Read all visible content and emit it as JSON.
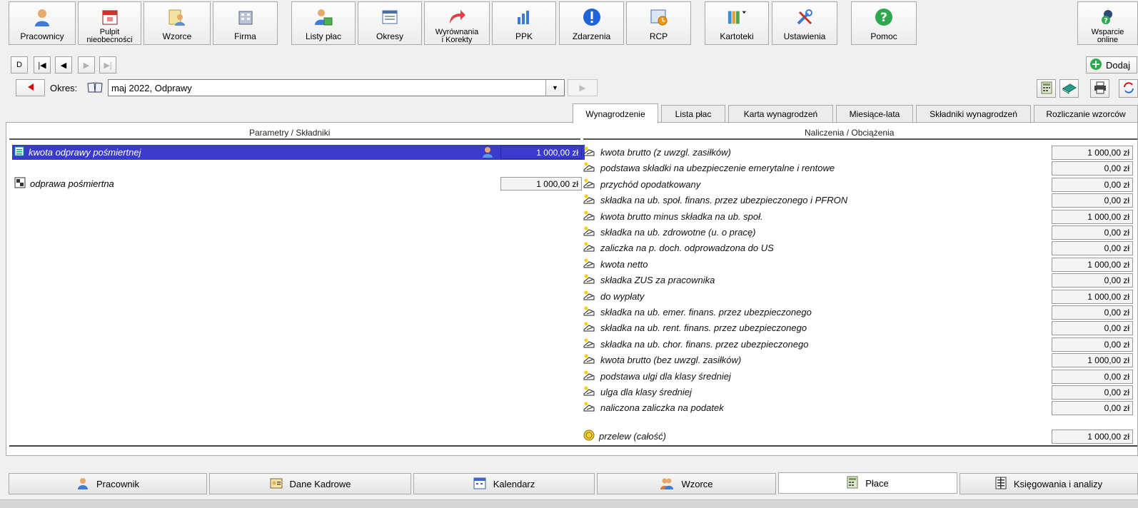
{
  "toolbar": {
    "pracownicy": "Pracownicy",
    "pulpit": "Pulpit\nnieobecności",
    "wzorce": "Wzorce",
    "firma": "Firma",
    "listy_plac": "Listy płac",
    "okresy": "Okresy",
    "wyrownania": "Wyrównania\ni Korekty",
    "ppk": "PPK",
    "zdarzenia": "Zdarzenia",
    "rcp": "RCP",
    "kartoteki": "Kartoteki",
    "ustawienia": "Ustawienia",
    "pomoc": "Pomoc",
    "wsparcie": "Wsparcie\nonline"
  },
  "nav": {
    "first_label": "D",
    "dodaj": "Dodaj"
  },
  "period": {
    "label": "Okres:",
    "value": "maj 2022, Odprawy"
  },
  "tabs": [
    {
      "label": "Wynagrodzenie",
      "active": true
    },
    {
      "label": "Lista płac"
    },
    {
      "label": "Karta wynagrodzeń"
    },
    {
      "label": "Miesiące-lata"
    },
    {
      "label": "Składniki wynagrodzeń"
    },
    {
      "label": "Rozliczanie wzorców"
    }
  ],
  "left": {
    "header": "Parametry / Składniki",
    "rows": [
      {
        "name": "kwota odprawy pośmiertnej",
        "value": "1 000,00 zł"
      },
      {
        "name": "odprawa pośmiertna",
        "value": "1 000,00 zł"
      }
    ]
  },
  "right": {
    "header": "Naliczenia / Obciążenia",
    "rows": [
      {
        "name": "kwota brutto (z uwzgl. zasiłków)",
        "value": "1 000,00 zł"
      },
      {
        "name": "podstawa składki na ubezpieczenie emerytalne i rentowe",
        "value": "0,00 zł"
      },
      {
        "name": "przychód opodatkowany",
        "value": "0,00 zł"
      },
      {
        "name": "składka na ub. społ. finans. przez ubezpieczonego i PFRON",
        "value": "0,00 zł"
      },
      {
        "name": "kwota brutto minus składka na ub. społ.",
        "value": "1 000,00 zł"
      },
      {
        "name": "składka na ub. zdrowotne (u. o pracę)",
        "value": "0,00 zł"
      },
      {
        "name": "zaliczka na p. doch. odprowadzona do US",
        "value": "0,00 zł"
      },
      {
        "name": "kwota netto",
        "value": "1 000,00 zł"
      },
      {
        "name": "składka ZUS za pracownika",
        "value": "0,00 zł"
      },
      {
        "name": "do wypłaty",
        "value": "1 000,00 zł"
      },
      {
        "name": "składka na ub. emer. finans. przez ubezpieczonego",
        "value": "0,00 zł"
      },
      {
        "name": "składka na ub. rent. finans. przez ubezpieczonego",
        "value": "0,00 zł"
      },
      {
        "name": "składka na ub. chor. finans. przez ubezpieczonego",
        "value": "0,00 zł"
      },
      {
        "name": "kwota brutto (bez uwzgl. zasiłków)",
        "value": "1 000,00 zł"
      },
      {
        "name": "podstawa ulgi dla klasy średniej",
        "value": "0,00 zł"
      },
      {
        "name": "ulga dla klasy średniej",
        "value": "0,00 zł"
      },
      {
        "name": "naliczona zaliczka na podatek",
        "value": "0,00 zł"
      }
    ],
    "przelew": {
      "name": "przelew (całość)",
      "value": "1 000,00 zł"
    }
  },
  "bottom_tabs": [
    {
      "label": "Pracownik"
    },
    {
      "label": "Dane Kadrowe"
    },
    {
      "label": "Kalendarz"
    },
    {
      "label": "Wzorce"
    },
    {
      "label": "Płace",
      "active": true
    },
    {
      "label": "Księgowania i analizy"
    }
  ],
  "colors": {
    "selection": "#3a3acf",
    "accent_red": "#d01010",
    "help_green": "#2fa84f"
  }
}
